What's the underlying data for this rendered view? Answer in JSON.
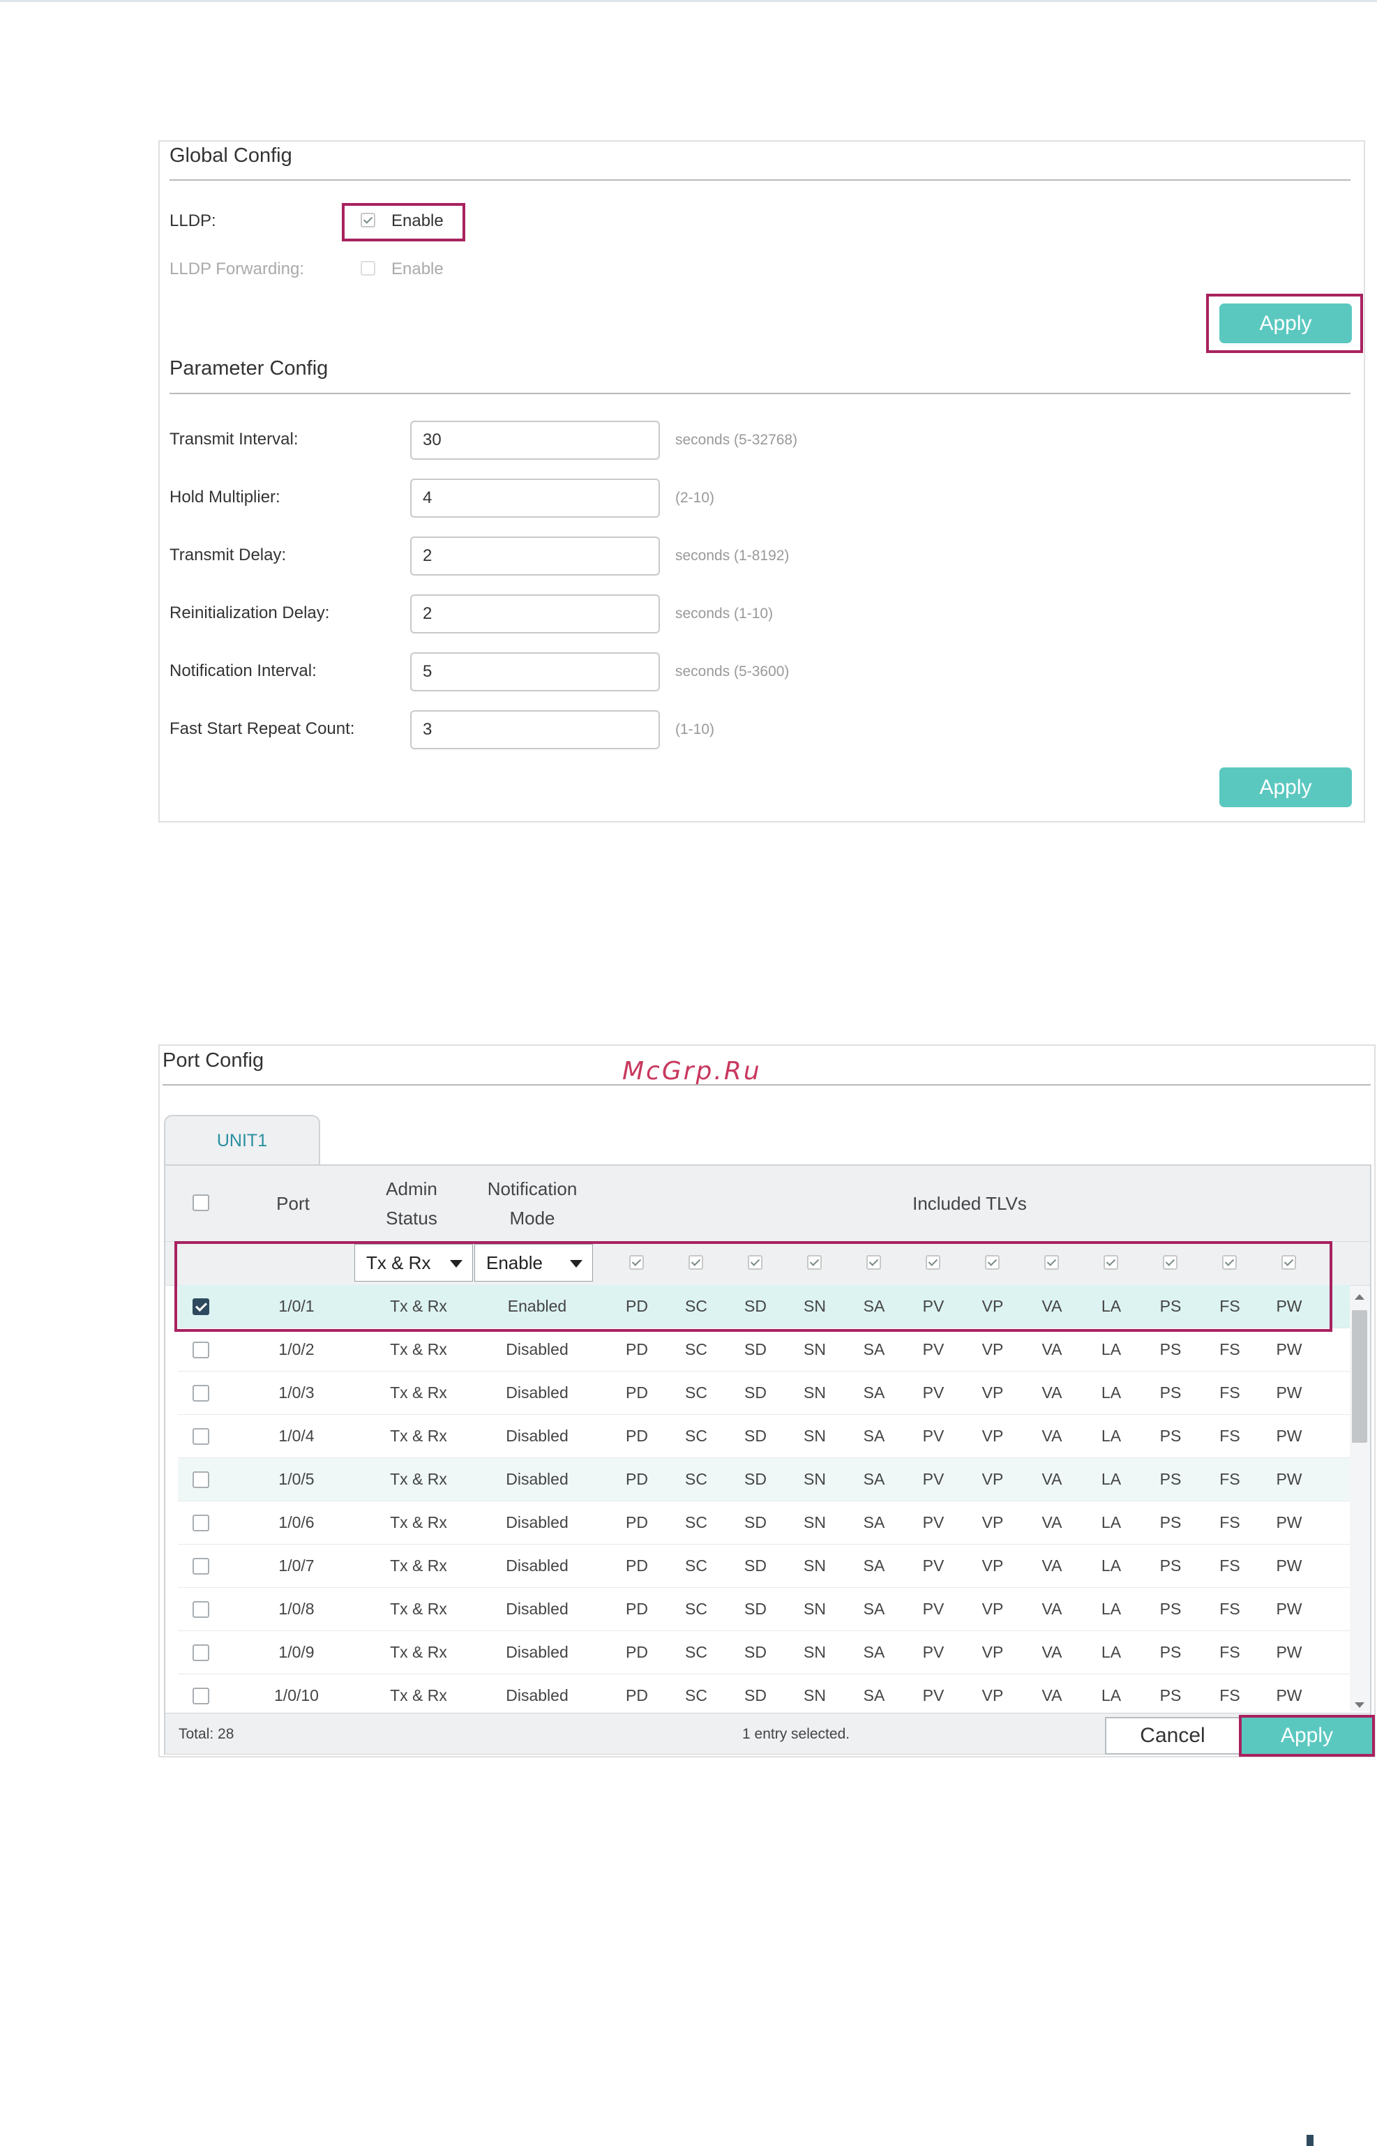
{
  "global_config": {
    "title": "Global Config",
    "lldp_label": "LLDP:",
    "lldp_enable_text": "Enable",
    "lldp_checked": true,
    "forwarding_label": "LLDP Forwarding:",
    "forwarding_enable_text": "Enable",
    "forwarding_checked": false,
    "apply_label": "Apply"
  },
  "parameter_config": {
    "title": "Parameter Config",
    "fields": [
      {
        "label": "Transmit Interval:",
        "value": "30",
        "hint": "seconds (5-32768)"
      },
      {
        "label": "Hold Multiplier:",
        "value": "4",
        "hint": "(2-10)"
      },
      {
        "label": "Transmit Delay:",
        "value": "2",
        "hint": "seconds (1-8192)"
      },
      {
        "label": "Reinitialization Delay:",
        "value": "2",
        "hint": "seconds (1-10)"
      },
      {
        "label": "Notification Interval:",
        "value": "5",
        "hint": "seconds (5-3600)"
      },
      {
        "label": "Fast Start Repeat Count:",
        "value": "3",
        "hint": "(1-10)"
      }
    ],
    "apply_label": "Apply"
  },
  "watermark": "McGrp.Ru",
  "port_config": {
    "title": "Port Config",
    "tab": "UNIT1",
    "headers": {
      "port": "Port",
      "admin_1": "Admin",
      "admin_2": "Status",
      "notif_1": "Notification",
      "notif_2": "Mode",
      "tlvs": "Included TLVs"
    },
    "filter": {
      "admin_status": "Tx & Rx",
      "notification_mode": "Enable"
    },
    "tlv_codes": [
      "PD",
      "SC",
      "SD",
      "SN",
      "SA",
      "PV",
      "VP",
      "VA",
      "LA",
      "PS",
      "FS",
      "PW"
    ],
    "rows": [
      {
        "port": "1/0/1",
        "admin": "Tx & Rx",
        "mode": "Enabled",
        "checked": true
      },
      {
        "port": "1/0/2",
        "admin": "Tx & Rx",
        "mode": "Disabled",
        "checked": false
      },
      {
        "port": "1/0/3",
        "admin": "Tx & Rx",
        "mode": "Disabled",
        "checked": false
      },
      {
        "port": "1/0/4",
        "admin": "Tx & Rx",
        "mode": "Disabled",
        "checked": false
      },
      {
        "port": "1/0/5",
        "admin": "Tx & Rx",
        "mode": "Disabled",
        "checked": false
      },
      {
        "port": "1/0/6",
        "admin": "Tx & Rx",
        "mode": "Disabled",
        "checked": false
      },
      {
        "port": "1/0/7",
        "admin": "Tx & Rx",
        "mode": "Disabled",
        "checked": false
      },
      {
        "port": "1/0/8",
        "admin": "Tx & Rx",
        "mode": "Disabled",
        "checked": false
      },
      {
        "port": "1/0/9",
        "admin": "Tx & Rx",
        "mode": "Disabled",
        "checked": false
      },
      {
        "port": "1/0/10",
        "admin": "Tx & Rx",
        "mode": "Disabled",
        "checked": false
      }
    ],
    "total": "Total: 28",
    "selected_status": "1 entry selected.",
    "cancel_label": "Cancel",
    "apply_label": "Apply"
  },
  "colors": {
    "accent": "#5bc8c0",
    "highlight_box": "#a8225f",
    "selected_row": "#dcf3f1"
  }
}
